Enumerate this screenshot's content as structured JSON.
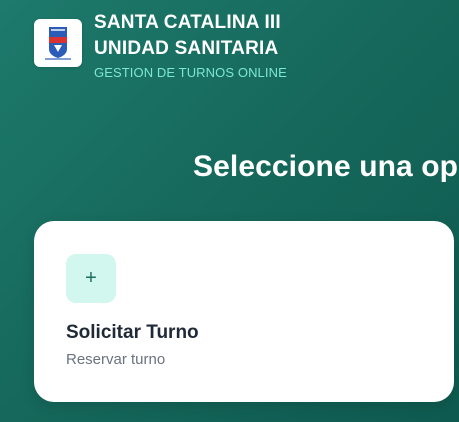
{
  "header": {
    "title_line1": "SANTA CATALINA III",
    "title_line2": "UNIDAD SANITARIA",
    "subtitle": "GESTION DE TURNOS ONLINE",
    "logo_icon": "municipal-shield-logo"
  },
  "main": {
    "heading": "Seleccione una op"
  },
  "card": {
    "icon": "plus-icon",
    "icon_glyph": "+",
    "title": "Solicitar Turno",
    "subtitle": "Reservar turno"
  },
  "colors": {
    "background": "#16695c",
    "accent": "#7ce8d2",
    "icon_bg": "#d2f7ee"
  }
}
